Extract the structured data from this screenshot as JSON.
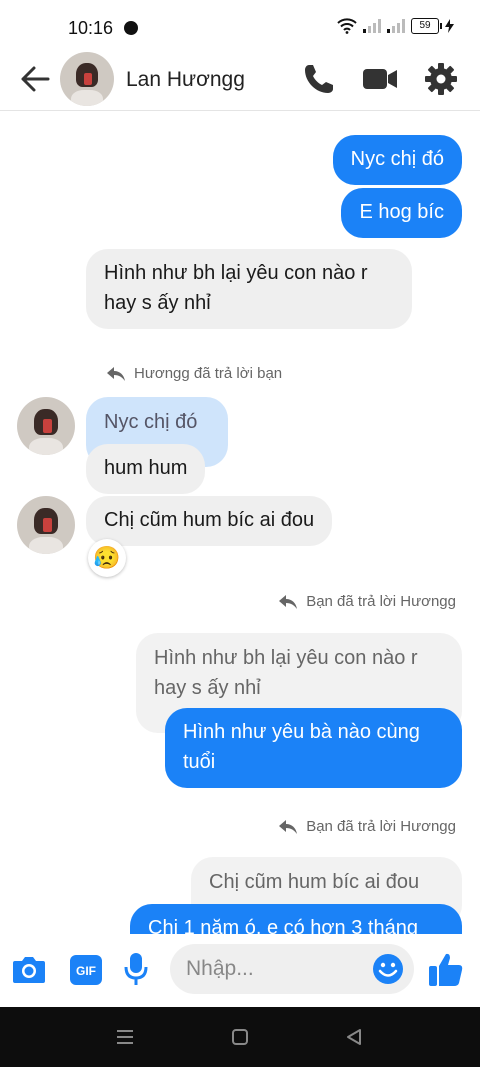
{
  "status": {
    "time": "10:16",
    "battery": "59"
  },
  "header": {
    "name": "Lan Hươngg"
  },
  "messages": {
    "m1": "Nyc chị đó",
    "m2": "E hog bíc",
    "m3": "Hình như bh lại yêu con nào r\nhay s ấy nhỉ",
    "note1": "Hươngg đã trả lời bạn",
    "q1": "Nyc chị đó",
    "m4": "hum hum",
    "m5": "Chị cũm hum bíc ai đou",
    "reaction": "😥",
    "note2": "Bạn đã trả lời Hươngg",
    "q2": "Hình như bh lại yêu con nào r\nhay s ấy nhỉ",
    "m6": "Hình như yêu bà nào cùng\ntuổi",
    "note3": "Bạn đã trả lời Hươngg",
    "q3": "Chị cũm hum bíc ai đou",
    "m7": "Chị 1 năm ó, e có hơn 3 tháng"
  },
  "input": {
    "placeholder": "Nhập..."
  },
  "icons": [
    "back-arrow-icon",
    "phone-icon",
    "video-icon",
    "gear-icon",
    "camera-icon",
    "gif-icon",
    "mic-icon",
    "emoji-icon",
    "thumbs-up-icon"
  ],
  "colors": {
    "accent": "#1b82f7",
    "incoming": "#efefef"
  }
}
